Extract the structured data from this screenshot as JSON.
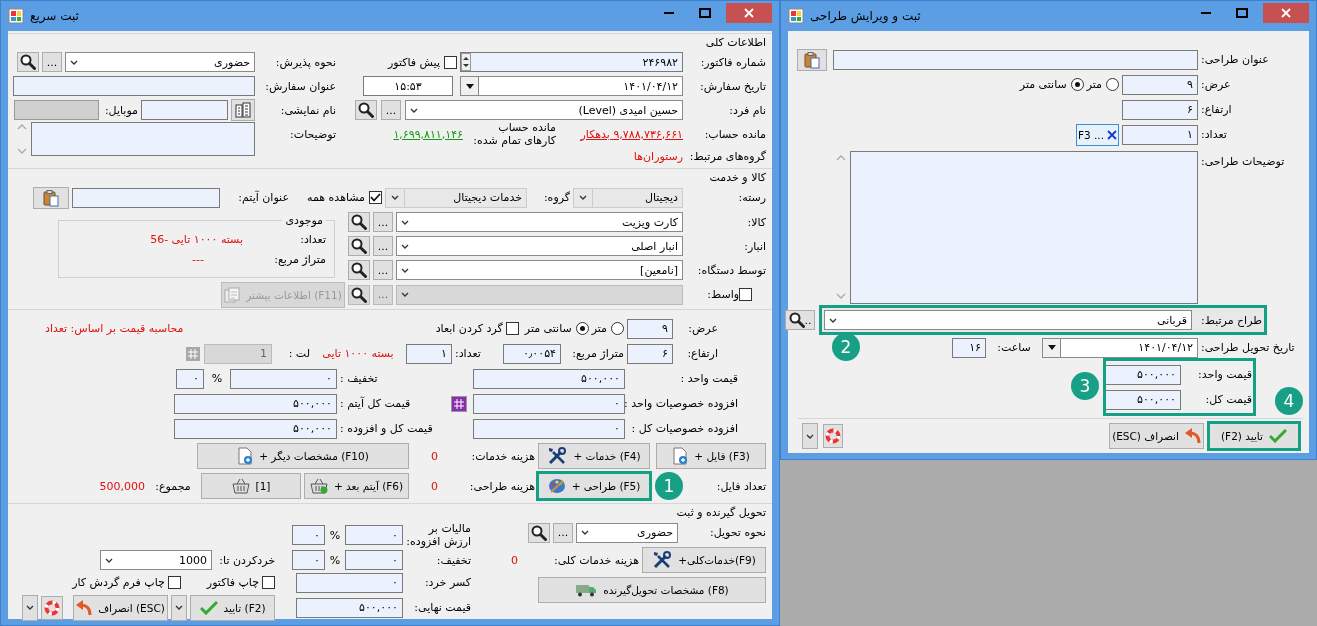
{
  "main_window": {
    "title": "ثبت سریع",
    "general": {
      "heading": "اطلاعات کلی",
      "invoice_number": {
        "label": "شماره فاکتور:",
        "value": "۲۴۶۹۸۲"
      },
      "proforma": {
        "label": "پیش فاکتور",
        "checked": false
      },
      "reception": {
        "label": "نحوه پذیرش:",
        "value": "حضوری",
        "lookup": "..."
      },
      "order_date": {
        "label": "تاریخ سفارش:",
        "value": "۱۴۰۱/۰۴/۱۲"
      },
      "order_time": {
        "value": "۱۵:۵۳"
      },
      "order_title": {
        "label": "عنوان سفارش:"
      },
      "person": {
        "label": "نام فرد:",
        "value": "حسین امیدی (Level)",
        "lookup": "..."
      },
      "display_name": {
        "label": "نام نمایشی:"
      },
      "mobile": {
        "label": "موبایل:"
      },
      "balance": {
        "label": "مانده حساب:",
        "value": "۹,۷۸۸,۷۳۶,۶۶۱ بدهکار"
      },
      "completed_balance": {
        "label_lines": [
          "مانده حساب",
          "کارهای تمام شده:"
        ],
        "value": "۱,۶۹۹,۸۱۱,۱۴۶"
      },
      "notes": {
        "label": "توضیحات:"
      },
      "related_groups": {
        "label": "گروه‌های مرتبط:",
        "value": "رستوران‌ها"
      }
    },
    "goods": {
      "heading": "کالا و خدمت",
      "category": {
        "label": "رسته:",
        "value": "دیجیتال"
      },
      "group": {
        "label": "گروه:",
        "value": "خدمات دیجیتال"
      },
      "show_all": {
        "label": "مشاهده همه",
        "checked": true
      },
      "item_title": {
        "label": "عنوان آیتم:"
      },
      "lookups": [
        {
          "label": "کالا:",
          "value": "کارت ویزیت",
          "lookup": "..."
        },
        {
          "label": "انبار:",
          "value": "انبار اصلی",
          "lookup": "..."
        },
        {
          "label": "توسط دستگاه:",
          "value": "[نامعین]",
          "lookup": "..."
        }
      ],
      "stock": {
        "heading": "موجودی",
        "count_label": "تعداد:",
        "count": "بسته ۱۰۰۰ تایی -56",
        "area_label": "متراژ مربع:",
        "area": "---"
      },
      "intermediary": {
        "label": "واسط:",
        "checked": false,
        "disabled": true,
        "lookup": "...",
        "more_info": "اطلاعات بیشتر (F11)"
      }
    },
    "dimensions": {
      "width": {
        "label": "عرض:",
        "value": "۹"
      },
      "units": [
        {
          "label": "متر",
          "selected": false
        },
        {
          "label": "سانتی متر",
          "selected": true
        }
      ],
      "round": {
        "label": "گرد کردن ابعاد",
        "checked": false
      },
      "pricing_basis": "محاسبه قیمت بر اساس: تعداد",
      "height": {
        "label": "ارتفاع:",
        "value": "۶"
      },
      "area": {
        "label": "متراژ مربع:",
        "value": "۰٫۰۰۵۴"
      },
      "quantity": {
        "label": "تعداد:",
        "value": "۱"
      },
      "package": "بسته ۱۰۰۰ تایی",
      "lot": {
        "label": "لت :",
        "value": "1",
        "disabled": true
      }
    },
    "prices": {
      "unit_price": {
        "label": "قیمت واحد :",
        "value": "۵۰۰,۰۰۰"
      },
      "discount": {
        "label": "تخفیف :",
        "value": "۰",
        "percent_sign": "%",
        "percent": "۰"
      },
      "unit_extras": {
        "label": "افزوده خصوصیات واحد :",
        "value": "۰"
      },
      "item_total": {
        "label": "قیمت کل آیتم :",
        "value": "۵۰۰,۰۰۰"
      },
      "total_extras": {
        "label": "افزوده خصوصیات کل :",
        "value": "۰"
      },
      "total_with_extras": {
        "label": "قیمت کل و افزوده :",
        "value": "۵۰۰,۰۰۰"
      }
    },
    "actions": {
      "file_button": "+ فایل (F3)",
      "services_button": "+ خدمات (F4)",
      "services_cost": {
        "label": "هزینه خدمات:",
        "value": "0"
      },
      "other_specs_button": "+ مشخصات دیگر (F10)",
      "file_count": {
        "label": "تعداد فایل:"
      },
      "design_button": {
        "label": "+ طراحی (F5)",
        "callout": "1"
      },
      "design_cost": {
        "label": "هزینه طراحی:",
        "value": "0"
      },
      "next_item_button": "+ آیتم بعد (F6)",
      "cart_button": "[1]",
      "sum": {
        "label": "مجموع:",
        "value": "500,000"
      }
    },
    "delivery": {
      "heading": "تحویل گیرنده و ثبت",
      "method": {
        "label": "نحوه تحویل:",
        "value": "حضوری",
        "lookup": "..."
      },
      "general_services_button": "+خدمات‌کلی(F9)",
      "general_services_cost": {
        "label": "هزینه خدمات کلی:",
        "value": "0"
      },
      "recipient_button": "مشخصات تحویل‌گیرنده (F8)",
      "vat": {
        "label_lines": [
          "مالیات بر",
          "ارزش افزوده:"
        ],
        "value": "۰",
        "percent_sign": "%",
        "percent": "۰"
      },
      "discount": {
        "label": "تخفیف:",
        "value": "۰",
        "percent_sign": "%",
        "percent": "۰"
      },
      "rounding_deduction": {
        "label": "کسر خرد:",
        "value": "۰"
      },
      "final_price": {
        "label": "قیمت نهایی:",
        "value": "۵۰۰,۰۰۰"
      },
      "round_to": {
        "label": "خردکردن تا:",
        "value": "1000"
      },
      "print_invoice": {
        "label": "چاپ فاکتور",
        "checked": false
      },
      "print_workflow": {
        "label": "چاپ فرم گردش کار",
        "checked": false
      },
      "confirm_button": "تایید (F2)",
      "cancel_button": "انصراف (ESC)"
    }
  },
  "design_window": {
    "title": "ثبت و ویرایش طراحی",
    "design_title": {
      "label": "عنوان طراحی:"
    },
    "width": {
      "label": "عرض:",
      "value": "۹"
    },
    "units": [
      {
        "label": "متر",
        "selected": false
      },
      {
        "label": "سانتی متر",
        "selected": true
      }
    ],
    "height": {
      "label": "ارتفاع:",
      "value": "۶"
    },
    "quantity": {
      "label": "تعداد:",
      "value": "۱"
    },
    "file_button": "F3 ...",
    "description": {
      "label": "توضیحات طراحی:"
    },
    "designer": {
      "label": "طراح مرتبط:",
      "value": "قربانی",
      "lookup": "..",
      "callout": "2"
    },
    "delivery_date": {
      "label": "تاریخ تحویل طراحی:",
      "value": "۱۴۰۱/۰۴/۱۲"
    },
    "hour": {
      "label": "ساعت:",
      "value": "۱۶"
    },
    "prices": {
      "callout": "3",
      "unit_price": {
        "label": "قیمت واحد:",
        "value": "۵۰۰,۰۰۰"
      },
      "total_price": {
        "label": "قیمت کل:",
        "value": "۵۰۰,۰۰۰"
      }
    },
    "confirm_button": {
      "label": "(F2) تایید",
      "callout": "4"
    },
    "cancel_button": "(ESC) انصراف"
  }
}
